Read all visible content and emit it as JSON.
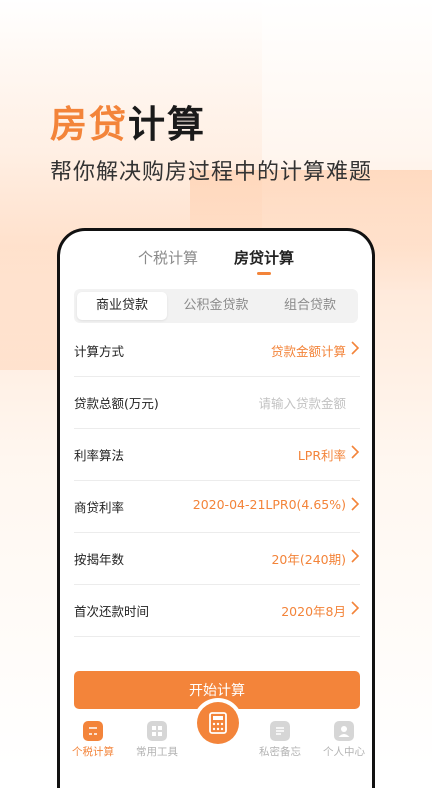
{
  "hero": {
    "title_accent": "房贷",
    "title_rest": "计算",
    "subtitle": "帮你解决购房过程中的计算难题"
  },
  "top_tabs": [
    {
      "label": "个税计算",
      "active": false
    },
    {
      "label": "房贷计算",
      "active": true
    }
  ],
  "segments": [
    {
      "label": "商业贷款",
      "active": true
    },
    {
      "label": "公积金贷款",
      "active": false
    },
    {
      "label": "组合贷款",
      "active": false
    }
  ],
  "rows": [
    {
      "label": "计算方式",
      "value": "贷款金额计算"
    },
    {
      "label": "贷款总额(万元)",
      "placeholder": "请输入贷款金额"
    },
    {
      "label": "利率算法",
      "value": "LPR利率"
    },
    {
      "label": "商贷利率",
      "value": "2020-04-21LPR0(4.65%)"
    },
    {
      "label": "按揭年数",
      "value": "20年(240期)"
    },
    {
      "label": "首次还款时间",
      "value": "2020年8月"
    }
  ],
  "start_button": "开始计算",
  "tabbar": [
    {
      "label": "个税计算",
      "icon": "calculator-icon",
      "active": true
    },
    {
      "label": "常用工具",
      "icon": "grid-icon",
      "active": false
    },
    {
      "label": "私密备忘",
      "icon": "note-icon",
      "active": false
    },
    {
      "label": "个人中心",
      "icon": "user-icon",
      "active": false
    }
  ],
  "colors": {
    "accent": "#f3843a"
  }
}
